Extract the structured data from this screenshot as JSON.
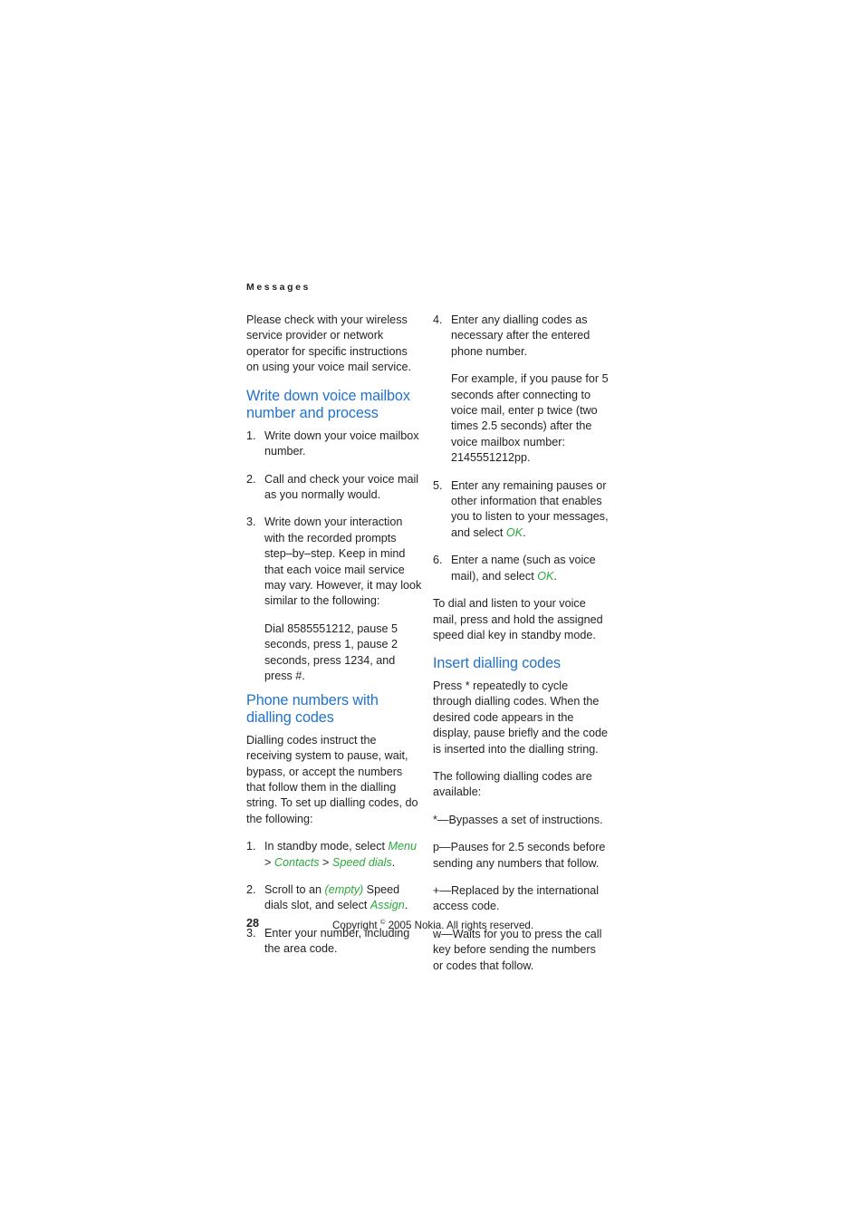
{
  "document": {
    "running_head": "Messages",
    "page_number": "28",
    "copyright_before": "Copyright ",
    "copyright_symbol": "©",
    "copyright_after": " 2005 Nokia. All rights reserved.",
    "heading_color": "#2272c8",
    "ui_ref_color": "#2aa83c",
    "body_color": "#231f20",
    "background_color": "#ffffff"
  },
  "left_column": {
    "intro_paragraph": "Please check with your wireless service provider or network operator for specific instructions on using your voice mail service.",
    "section_1": {
      "heading": "Write down voice mailbox number and process",
      "items": [
        {
          "marker": "1.",
          "text": "Write down your voice mailbox number."
        },
        {
          "marker": "2.",
          "text": "Call and check your voice mail as you normally would."
        },
        {
          "marker": "3.",
          "text": "Write down your interaction with the recorded prompts step–by–step. Keep in mind that each voice mail service may vary. However, it may look similar to the following:",
          "sub_text": "Dial 8585551212, pause 5 seconds, press 1, pause 2 seconds, press 1234, and press #."
        }
      ]
    },
    "section_2": {
      "heading": "Phone numbers with dialling codes",
      "paragraph": "Dialling codes instruct the receiving system to pause, wait, bypass, or accept the numbers that follow them in the dialling string. To set up dialling codes, do the following:",
      "items": [
        {
          "marker": "1.",
          "text_before": "In standby mode, select ",
          "ref_1": "Menu",
          "sep_1": " > ",
          "ref_2": "Contacts",
          "sep_2": " > ",
          "ref_3": "Speed dials",
          "text_after": "."
        },
        {
          "marker": "2.",
          "text_before": "Scroll to an ",
          "ref_1": "(empty)",
          "sep_1": " Speed dials slot, and select ",
          "ref_2": "Assign",
          "text_after": "."
        },
        {
          "marker": "3.",
          "text_before": "Enter your number, including the area code."
        }
      ]
    }
  },
  "right_column": {
    "items": [
      {
        "marker": "4.",
        "text": "Enter any dialling codes as necessary after the entered phone number.",
        "sub_text": "For example, if you pause for 5 seconds after connecting to voice mail, enter p twice (two times 2.5 seconds) after the voice mailbox number: 2145551212pp."
      },
      {
        "marker": "5.",
        "text_before": "Enter any remaining pauses or other information that enables you to listen to your messages, and select ",
        "ref_1": "OK",
        "text_after": "."
      },
      {
        "marker": "6.",
        "text_before": "Enter a name (such as voice mail), and select ",
        "ref_1": "OK",
        "text_after": "."
      }
    ],
    "closing_paragraph": "To dial and listen to your voice mail, press and hold the assigned speed dial key in standby mode.",
    "section_3": {
      "heading": "Insert dialling codes",
      "paragraph_1": "Press * repeatedly to cycle through dialling codes. When the desired code appears in the display, pause briefly and the code is inserted into the dialling string.",
      "paragraph_2": "The following dialling codes are available:",
      "codes": [
        "*—Bypasses a set of instructions.",
        "p—Pauses for 2.5 seconds before sending any numbers that follow.",
        "+—Replaced by the international access code.",
        "w—Waits for you to press the call key before sending the numbers or codes that follow."
      ]
    }
  }
}
